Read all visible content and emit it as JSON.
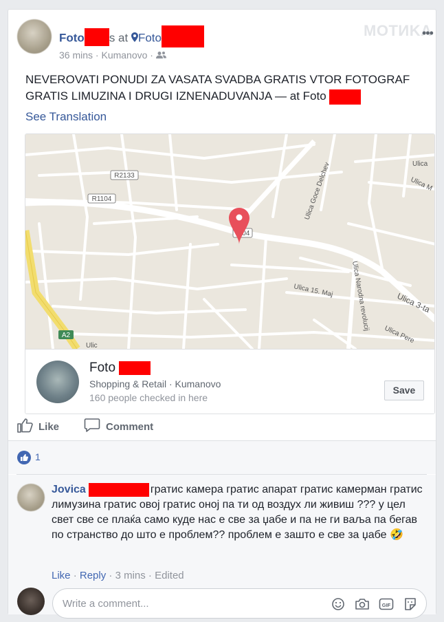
{
  "post": {
    "author_prefix": "Foto",
    "at_text": "s at",
    "place_prefix": "Foto",
    "time": "36 mins",
    "location": "Kumanovo",
    "text": "NEVEROVATI PONUDI ZA VASATA SVADBA GRATIS VTOR FOTOGRAF GRATIS LIMUZINA I DRUGI IZNENADUVANJA — at Foto",
    "see_translation": "See Translation",
    "watermark": "MOTИKA"
  },
  "map": {
    "road_labels": [
      "R2133",
      "R1104",
      "104",
      "A2",
      "Ulica Goce Delchev",
      "Ulica 15. Maj",
      "Ulica Narodna revolucij",
      "Ulica 3-ta",
      "Ulica Pere",
      "Ulica",
      "Ulica M",
      "Ulic"
    ],
    "pin_color": "#e8505b"
  },
  "place": {
    "name": "Foto",
    "category": "Shopping & Retail · Kumanovo",
    "checkins": "160 people checked in here",
    "save_label": "Save"
  },
  "actions": {
    "like": "Like",
    "comment": "Comment"
  },
  "reactions": {
    "count": "1"
  },
  "comment": {
    "author": "Jovica",
    "text_line1": "гратис камера гратис апарат гратис камерман",
    "text_rest": "гратис лимузина гратис овој гратис оној па ти од воздух ли живиш ??? у цел свет све се плаќа само куде нас е све за џабе и па не ги вaља па бегав по странство до што е проблем?? проблем е зашто е све за џабе",
    "emoji": "🤣",
    "like": "Like",
    "reply": "Reply",
    "time": "3 mins",
    "edited": "Edited"
  },
  "composer": {
    "placeholder": "Write a comment..."
  },
  "colors": {
    "link": "#365899",
    "accent": "#4267b2",
    "redaction": "#ff0000"
  }
}
